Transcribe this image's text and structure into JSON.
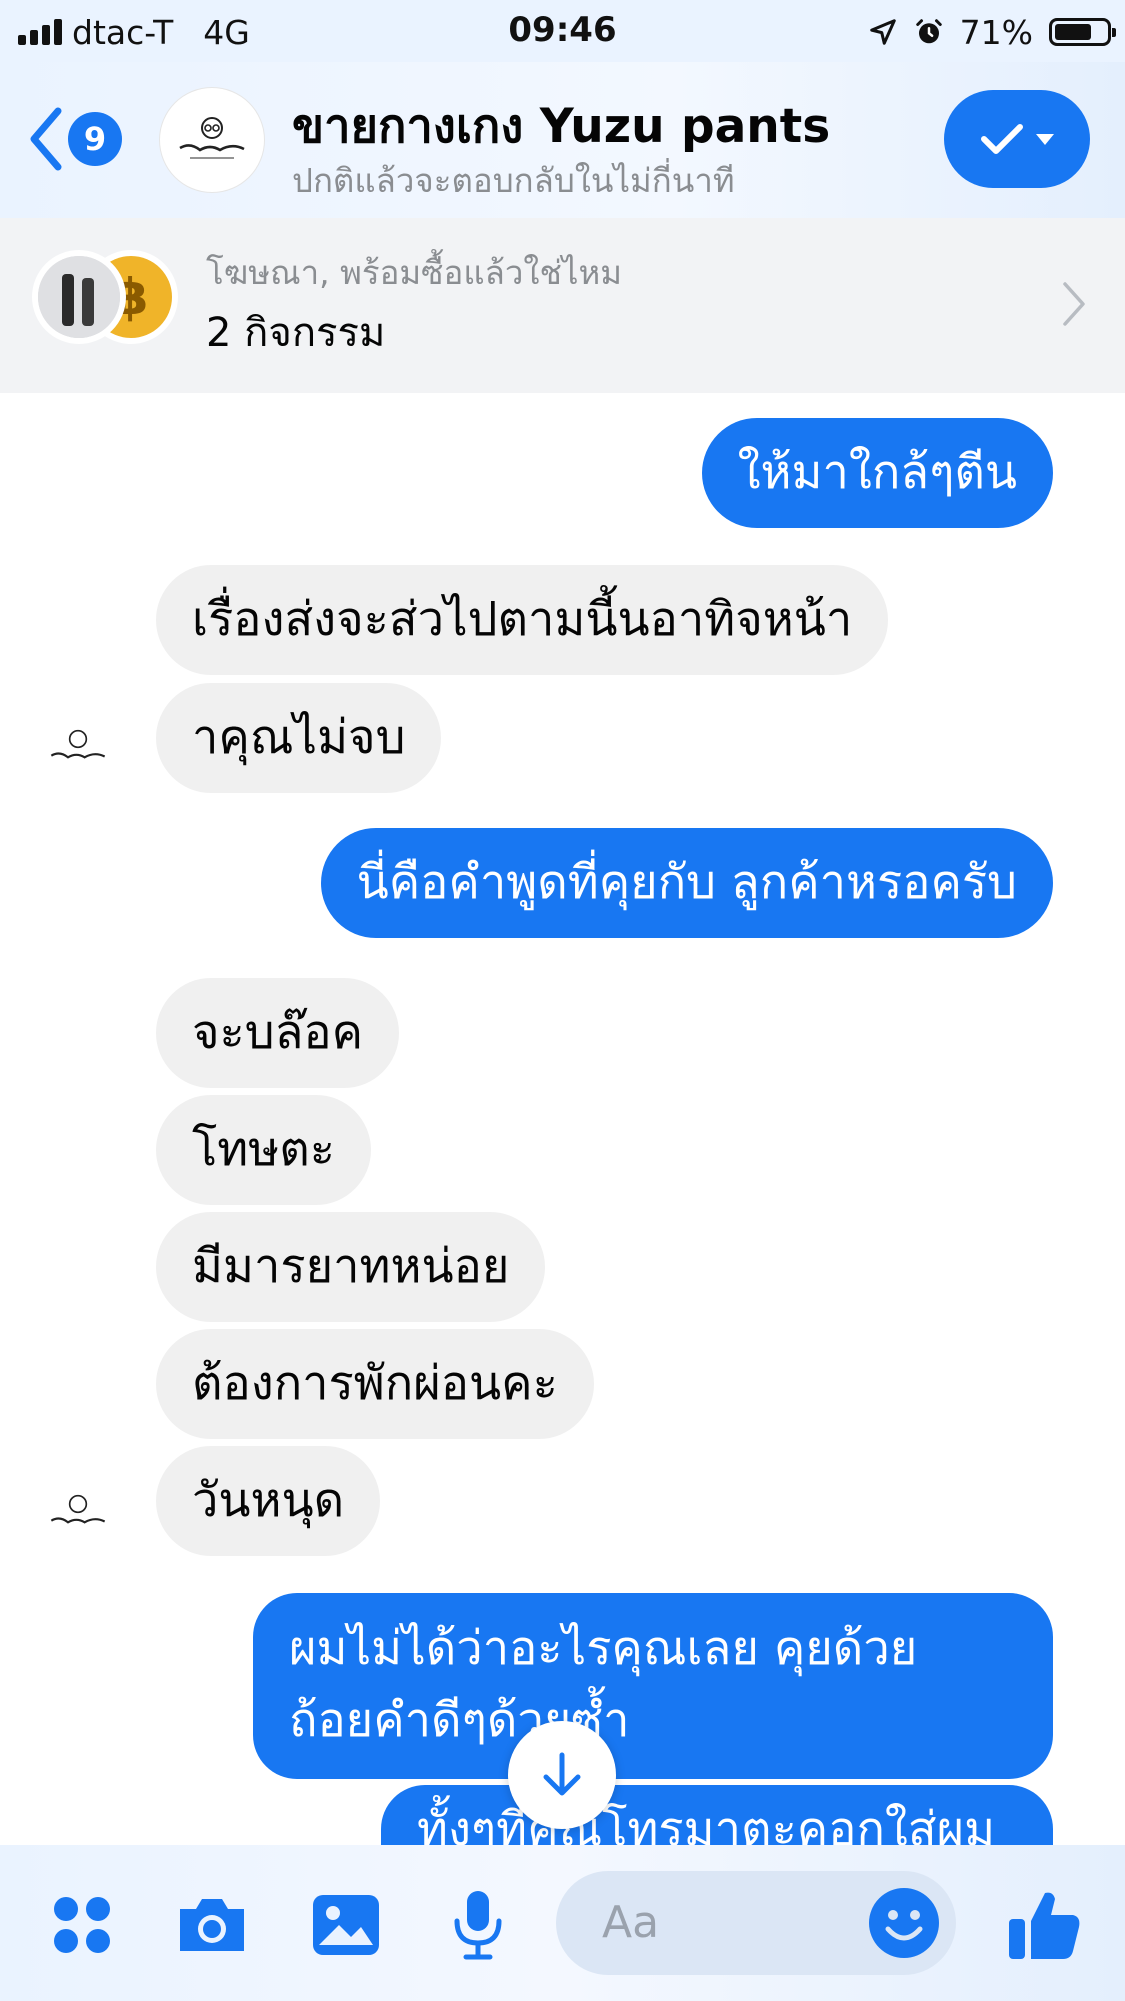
{
  "status_bar": {
    "carrier": "dtac-T",
    "network": "4G",
    "time": "09:46",
    "battery_percent": "71%",
    "battery_level": 0.71
  },
  "header": {
    "unread_count": "9",
    "title": "ขายกางเกง Yuzu pants",
    "subtitle": "ปกติแล้วจะตอบกลับในไม่กี่นาที",
    "accent_color": "#1877f2"
  },
  "ad_banner": {
    "line1": "โฆษณา, พร้อมซื้อแล้วใช่ไหม",
    "line2": "2 กิจกรรม"
  },
  "messages": [
    {
      "side": "out",
      "text": "ให้มาใกล้ๆตีน"
    },
    {
      "side": "in",
      "text": "เรื่องส่งจะส่วไปตามนี้นอาทิจหน้า"
    },
    {
      "side": "in",
      "text": "าคุณไม่จบ"
    },
    {
      "side": "out",
      "text": "นี่คือคำพูดที่คุยกับ ลูกค้าหรอครับ"
    },
    {
      "side": "in",
      "text": "จะบล๊อค"
    },
    {
      "side": "in",
      "text": "โทษตะ"
    },
    {
      "side": "in",
      "text": "มีมารยาทหน่อย"
    },
    {
      "side": "in",
      "text": "ต้องการพักผ่อนคะ"
    },
    {
      "side": "in",
      "text": "วันหนุด"
    },
    {
      "side": "out",
      "text": "ผมไม่ได้ว่าอะไรคุณเลย คุยด้วยถ้อยคำดีๆด้วยซ้ำ"
    },
    {
      "side": "out",
      "text": "ทั้งๆที่คุณโทรมาตะคอกใส่ผม"
    }
  ],
  "composer": {
    "placeholder": "Aa"
  },
  "icons": [
    "signal-icon",
    "location-icon",
    "alarm-icon",
    "battery-icon",
    "back-icon",
    "check-icon",
    "chevron-right-icon",
    "arrow-down-icon",
    "apps-icon",
    "camera-icon",
    "gallery-icon",
    "microphone-icon",
    "emoji-icon",
    "like-icon"
  ]
}
